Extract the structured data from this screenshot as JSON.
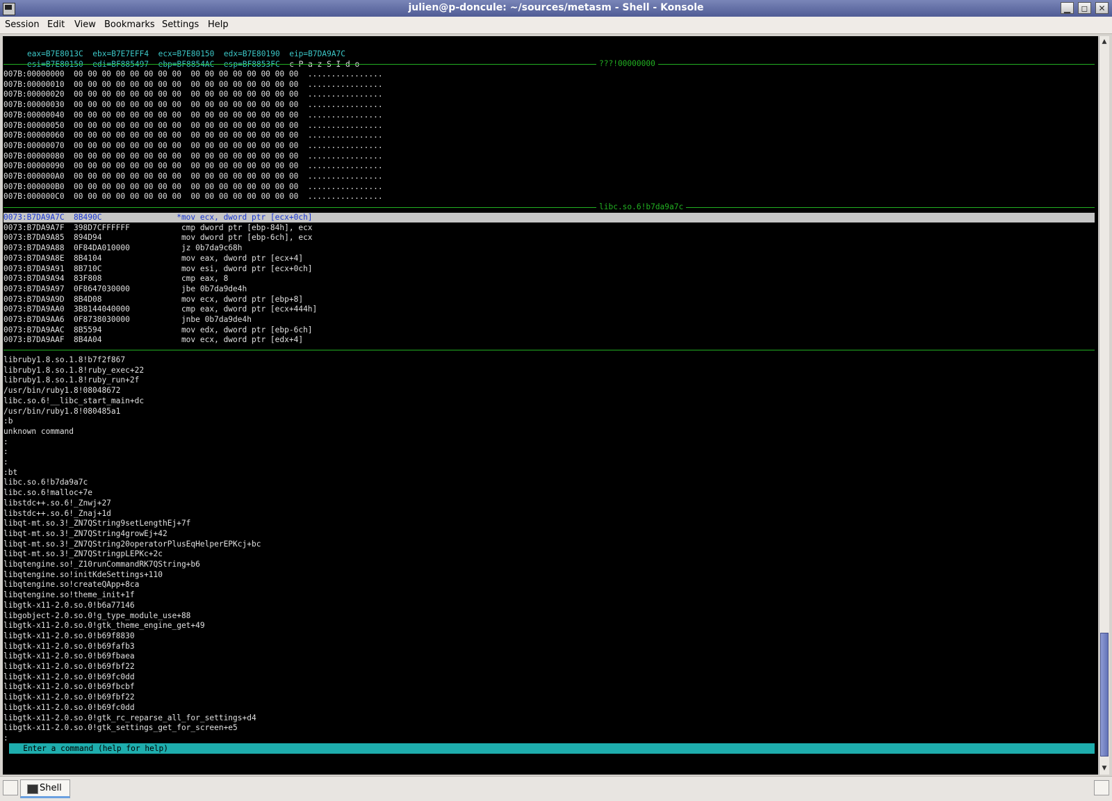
{
  "window": {
    "title": "julien@p-doncule: ~/sources/metasm - Shell - Konsole",
    "minimize": "▁",
    "maximize": "◻",
    "close": "✕"
  },
  "menu": [
    "Session",
    "Edit",
    "View",
    "Bookmarks",
    "Settings",
    "Help"
  ],
  "registers": {
    "row1": [
      "eax=B7E8013C",
      "ebx=B7E7EFF4",
      "ecx=B7E80150",
      "edx=B7E80190",
      "eip=B7DA9A7C"
    ],
    "row2": [
      "esi=B7E80150",
      "edi=BF885497",
      "ebp=BF8854AC",
      "esp=BF8853FC"
    ],
    "flags": "c P a z S I d o"
  },
  "hex_section_label": "???!00000000",
  "hex_lines": [
    "007B:00000000  00 00 00 00 00 00 00 00  00 00 00 00 00 00 00 00  ................",
    "007B:00000010  00 00 00 00 00 00 00 00  00 00 00 00 00 00 00 00  ................",
    "007B:00000020  00 00 00 00 00 00 00 00  00 00 00 00 00 00 00 00  ................",
    "007B:00000030  00 00 00 00 00 00 00 00  00 00 00 00 00 00 00 00  ................",
    "007B:00000040  00 00 00 00 00 00 00 00  00 00 00 00 00 00 00 00  ................",
    "007B:00000050  00 00 00 00 00 00 00 00  00 00 00 00 00 00 00 00  ................",
    "007B:00000060  00 00 00 00 00 00 00 00  00 00 00 00 00 00 00 00  ................",
    "007B:00000070  00 00 00 00 00 00 00 00  00 00 00 00 00 00 00 00  ................",
    "007B:00000080  00 00 00 00 00 00 00 00  00 00 00 00 00 00 00 00  ................",
    "007B:00000090  00 00 00 00 00 00 00 00  00 00 00 00 00 00 00 00  ................",
    "007B:000000A0  00 00 00 00 00 00 00 00  00 00 00 00 00 00 00 00  ................",
    "007B:000000B0  00 00 00 00 00 00 00 00  00 00 00 00 00 00 00 00  ................",
    "007B:000000C0  00 00 00 00 00 00 00 00  00 00 00 00 00 00 00 00  ................"
  ],
  "disasm_section_label": "libc.so.6!b7da9a7c",
  "disasm_lines": [
    "0073:B7DA9A7C  8B490C                *mov ecx, dword ptr [ecx+0ch]",
    "0073:B7DA9A7F  398D7CFFFFFF           cmp dword ptr [ebp-84h], ecx",
    "0073:B7DA9A85  894D94                 mov dword ptr [ebp-6ch], ecx",
    "0073:B7DA9A88  0F84DA010000           jz 0b7da9c68h",
    "0073:B7DA9A8E  8B4104                 mov eax, dword ptr [ecx+4]",
    "0073:B7DA9A91  8B710C                 mov esi, dword ptr [ecx+0ch]",
    "0073:B7DA9A94  83F808                 cmp eax, 8",
    "0073:B7DA9A97  0F8647030000           jbe 0b7da9de4h",
    "0073:B7DA9A9D  8B4D08                 mov ecx, dword ptr [ebp+8]",
    "0073:B7DA9AA0  3B8144040000           cmp eax, dword ptr [ecx+444h]",
    "0073:B7DA9AA6  0F8738030000           jnbe 0b7da9de4h",
    "0073:B7DA9AAC  8B5594                 mov edx, dword ptr [ebp-6ch]",
    "0073:B7DA9AAF  8B4A04                 mov ecx, dword ptr [edx+4]"
  ],
  "log_lines": [
    "libruby1.8.so.1.8!b7f2f867",
    "libruby1.8.so.1.8!ruby_exec+22",
    "libruby1.8.so.1.8!ruby_run+2f",
    "/usr/bin/ruby1.8!08048672",
    "libc.so.6!__libc_start_main+dc",
    "/usr/bin/ruby1.8!080485a1",
    ":b",
    "unknown command",
    ":",
    ":",
    ":",
    ":bt",
    "libc.so.6!b7da9a7c",
    "libc.so.6!malloc+7e",
    "libstdc++.so.6!_Znwj+27",
    "libstdc++.so.6!_Znaj+1d",
    "libqt-mt.so.3!_ZN7QString9setLengthEj+7f",
    "libqt-mt.so.3!_ZN7QString4growEj+42",
    "libqt-mt.so.3!_ZN7QString20operatorPlusEqHelperEPKcj+bc",
    "libqt-mt.so.3!_ZN7QStringpLEPKc+2c",
    "libqtengine.so!_Z10runCommandRK7QString+b6",
    "libqtengine.so!initKdeSettings+110",
    "libqtengine.so!createQApp+8ca",
    "libqtengine.so!theme_init+1f",
    "libgtk-x11-2.0.so.0!b6a77146",
    "libgobject-2.0.so.0!g_type_module_use+88",
    "libgtk-x11-2.0.so.0!gtk_theme_engine_get+49",
    "libgtk-x11-2.0.so.0!b69f8830",
    "libgtk-x11-2.0.so.0!b69fafb3",
    "libgtk-x11-2.0.so.0!b69fbaea",
    "libgtk-x11-2.0.so.0!b69fbf22",
    "libgtk-x11-2.0.so.0!b69fc0dd",
    "libgtk-x11-2.0.so.0!b69fbcbf",
    "libgtk-x11-2.0.so.0!b69fbf22",
    "libgtk-x11-2.0.so.0!b69fc0dd",
    "libgtk-x11-2.0.so.0!gtk_rc_reparse_all_for_settings+d4",
    "libgtk-x11-2.0.so.0!gtk_settings_get_for_screen+e5",
    ":"
  ],
  "prompt": "   Enter a command (help for help)",
  "scrollbar": {
    "up": "▲",
    "down": "▼"
  },
  "taskbar": {
    "tab_label": "Shell"
  },
  "colors": {
    "register": "#3cc8c8",
    "separator": "#22b022",
    "prompt_bg": "#1eadad",
    "highlight": "#c6c6c6",
    "current_instr": "#1a37d2"
  }
}
